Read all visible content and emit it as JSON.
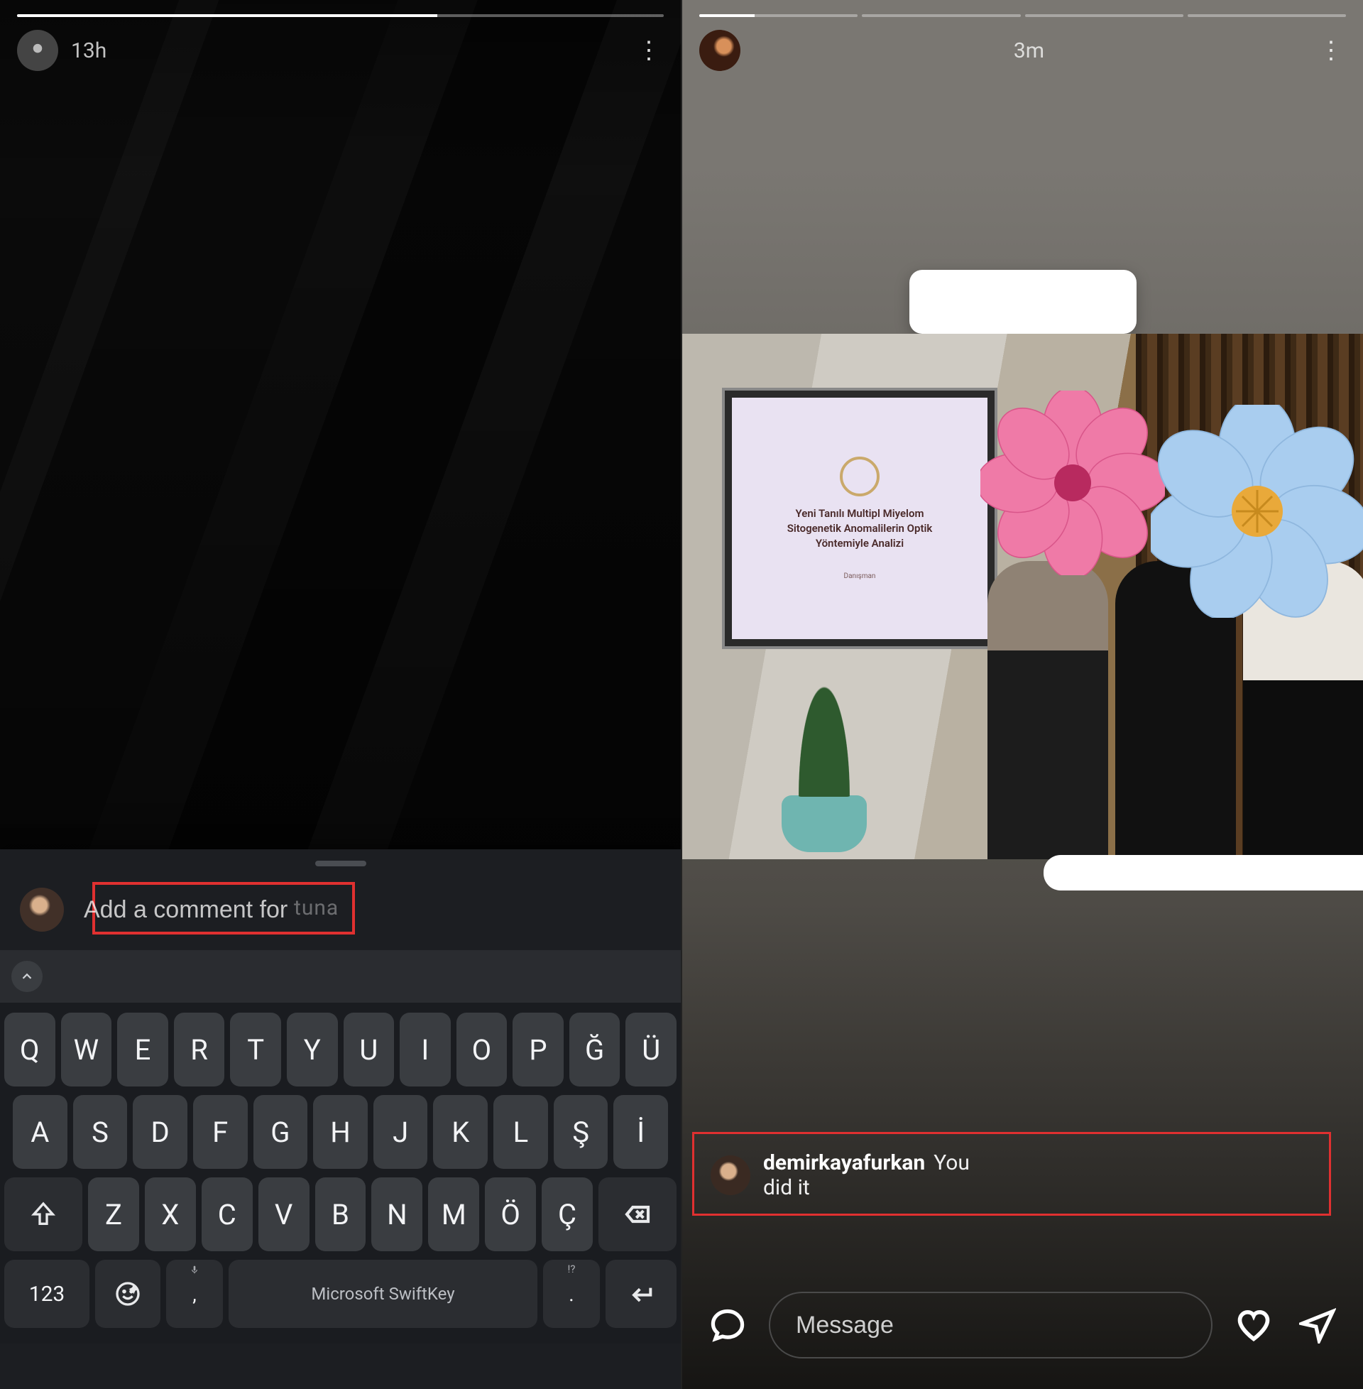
{
  "left": {
    "timestamp": "13h",
    "comment_placeholder": "Add a comment for",
    "comment_trailing": "tuna",
    "keyboard": {
      "row1": [
        "Q",
        "W",
        "E",
        "R",
        "T",
        "Y",
        "U",
        "I",
        "O",
        "P",
        "Ğ",
        "Ü"
      ],
      "row2": [
        "A",
        "S",
        "D",
        "F",
        "G",
        "H",
        "J",
        "K",
        "L",
        "Ş",
        "İ"
      ],
      "row3": [
        "Z",
        "X",
        "C",
        "V",
        "B",
        "N",
        "M",
        "Ö",
        "Ç"
      ],
      "numeric_label": "123",
      "space_label": "Microsoft SwiftKey",
      "comma": ",",
      "period": ".",
      "punct_hint": "!?"
    }
  },
  "right": {
    "timestamp": "3m",
    "progress_segments": 4,
    "progress_active_index": 0,
    "progress_fill_ratio": 0.35,
    "slide": {
      "line1": "Yeni Tanılı Multipl Miyelom",
      "line2": "Sitogenetik Anomalilerin Optik",
      "line3": "Yöntemiyle Analizi",
      "sub": "Danışman"
    },
    "comment": {
      "user": "demirkayafurkan",
      "text": "You did it"
    },
    "message_placeholder": "Message"
  }
}
